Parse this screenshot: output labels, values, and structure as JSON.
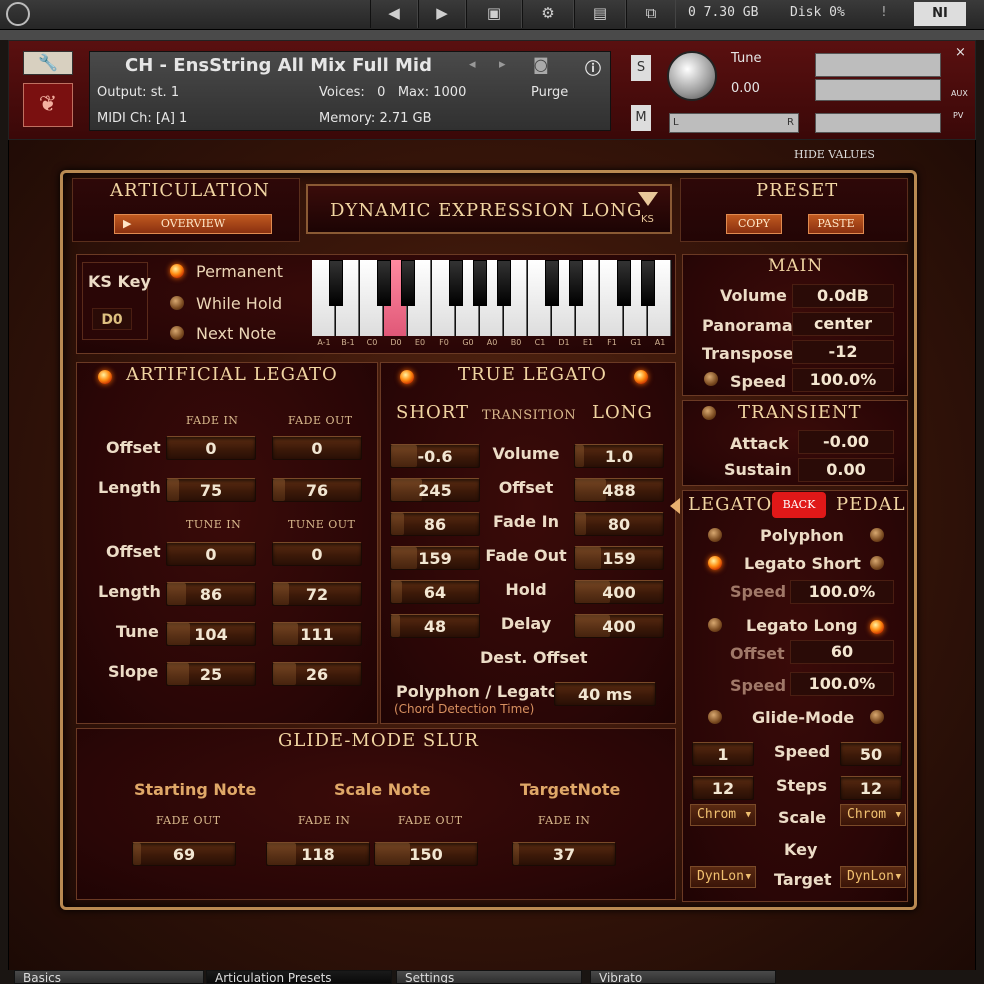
{
  "host": {
    "mem": "0 7.30 GB",
    "disk": "Disk 0%",
    "warn": "!"
  },
  "header": {
    "instrument": "CH - EnsString All Mix Full Mid",
    "output_label": "Output:",
    "output_value": "st. 1",
    "voices_label": "Voices:",
    "voices_value": "0",
    "max_label": "Max:",
    "max_value": "1000",
    "purge": "Purge",
    "midi_label": "MIDI Ch:",
    "midi_value": "[A] 1",
    "memory_label": "Memory:",
    "memory_value": "2.71 GB",
    "s": "S",
    "m": "M",
    "tune_label": "Tune",
    "tune_value": "0.00",
    "l": "L",
    "r": "R",
    "aux": "AUX",
    "pv": "PV"
  },
  "hide_values": "HIDE VALUES",
  "articulation": {
    "title": "ARTICULATION",
    "overview": "OVERVIEW",
    "name": "DYNAMIC EXPRESSION LONG",
    "ks": "KS"
  },
  "preset": {
    "title": "PRESET",
    "copy": "COPY",
    "paste": "PASTE"
  },
  "kskey": {
    "label": "KS Key",
    "value": "D0",
    "permanent": "Permanent",
    "while_hold": "While Hold",
    "next_note": "Next Note",
    "notes": [
      "A-1",
      "B-1",
      "C0",
      "D0",
      "E0",
      "F0",
      "G0",
      "A0",
      "B0",
      "C1",
      "D1",
      "E1",
      "F1",
      "G1",
      "A1"
    ]
  },
  "main": {
    "title": "MAIN",
    "volume_label": "Volume",
    "volume": "0.0dB",
    "panorama_label": "Panorama",
    "panorama": "center",
    "transpose_label": "Transpose",
    "transpose": "-12",
    "speed_label": "Speed",
    "speed": "100.0%"
  },
  "transient": {
    "title": "TRANSIENT",
    "attack_label": "Attack",
    "attack": "-0.00",
    "sustain_label": "Sustain",
    "sustain": "0.00"
  },
  "artificial": {
    "title": "ARTIFICIAL LEGATO",
    "fade_in": "FADE IN",
    "fade_out": "FADE OUT",
    "tune_in": "TUNE IN",
    "tune_out": "TUNE OUT",
    "offset": "Offset",
    "length": "Length",
    "tune": "Tune",
    "slope": "Slope",
    "f_offset_in": "0",
    "f_offset_out": "0",
    "f_length_in": "75",
    "f_length_out": "76",
    "t_offset_in": "0",
    "t_offset_out": "0",
    "t_length_in": "86",
    "t_length_out": "72",
    "tune_in_v": "104",
    "tune_out_v": "111",
    "slope_in": "25",
    "slope_out": "26"
  },
  "true_legato": {
    "title": "TRUE LEGATO",
    "short": "SHORT",
    "transition": "TRANSITION",
    "long": "LONG",
    "rows": [
      {
        "label": "Volume",
        "short": "-0.6",
        "long": "1.0"
      },
      {
        "label": "Offset",
        "short": "245",
        "long": "488"
      },
      {
        "label": "Fade In",
        "short": "86",
        "long": "80"
      },
      {
        "label": "Fade Out",
        "short": "159",
        "long": "159"
      },
      {
        "label": "Hold",
        "short": "64",
        "long": "400"
      },
      {
        "label": "Delay",
        "short": "48",
        "long": "400"
      }
    ],
    "dest_offset": "Dest. Offset",
    "polyphon_label": "Polyphon / Legato",
    "chord_label": "(Chord Detection Time)",
    "polyphon_value": "40 ms"
  },
  "legato_pedal": {
    "legato": "LEGATO",
    "back": "BACK",
    "pedal": "PEDAL",
    "polyphon": "Polyphon",
    "legato_short": "Legato Short",
    "speed_label": "Speed",
    "short_speed": "100.0%",
    "legato_long": "Legato Long",
    "offset_label": "Offset",
    "long_offset": "60",
    "long_speed": "100.0%",
    "glide_mode": "Glide-Mode",
    "g_speed_label": "Speed",
    "g_speed_a": "1",
    "g_speed_b": "50",
    "steps_label": "Steps",
    "steps_a": "12",
    "steps_b": "12",
    "scale_label": "Scale",
    "scale_a": "Chrom",
    "scale_b": "Chrom",
    "key_label": "Key",
    "target_label": "Target",
    "target_a": "DynLon",
    "target_b": "DynLon"
  },
  "glide": {
    "title": "GLIDE-MODE SLUR",
    "starting": "Starting Note",
    "scale": "Scale Note",
    "target": "TargetNote",
    "fade_out": "FADE OUT",
    "fade_in": "FADE IN",
    "start_fo": "69",
    "scale_fi": "118",
    "scale_fo": "150",
    "target_fi": "37"
  },
  "tabs": [
    "Basics",
    "Articulation Presets",
    "Settings",
    "Vibrato"
  ]
}
